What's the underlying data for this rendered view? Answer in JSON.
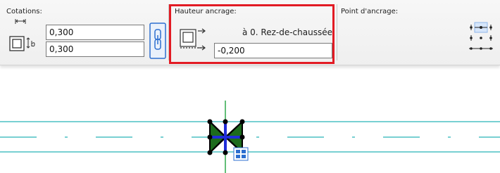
{
  "dimensions": {
    "title": "Cotations:",
    "width_value": "0,300",
    "depth_value": "0,300",
    "icons": [
      "width-arrow-icon",
      "frame-icon",
      "depth-arrow-icon",
      "chain-link-icon"
    ]
  },
  "anchor_height": {
    "title": "Hauteur ancrage:",
    "level_label": "à 0. Rez-de-chaussée",
    "offset_value": "-0,200",
    "highlight_color": "#e21b24"
  },
  "anchor_point": {
    "title": "Point d'ancrage:",
    "selected": "top-center"
  },
  "canvas": {
    "wall_line_color": "#27b3b8",
    "selection_color": "#1f2cd8",
    "object_fill": "#1d6b1d",
    "axis_color": "#2fa84a"
  }
}
